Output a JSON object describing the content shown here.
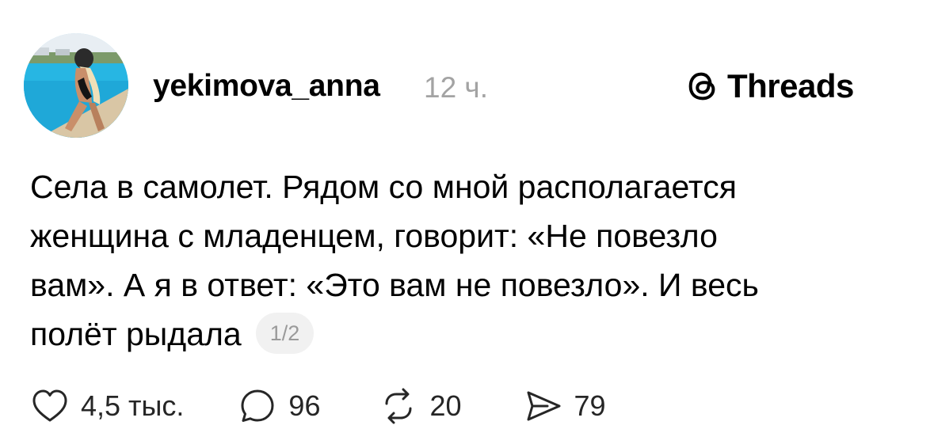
{
  "post": {
    "author": "yekimova_anna",
    "time": "12 ч.",
    "brand": "Threads",
    "text_lines": [
      "Села в самолет. Рядом со мной располагается",
      "женщина с младенцем, говорит: «Не повезло",
      "вам». А я в ответ: «Это вам не повезло». И весь",
      "полёт рыдала"
    ],
    "page_indicator": "1/2"
  },
  "actions": {
    "likes": "4,5 тыс.",
    "comments": "96",
    "reposts": "20",
    "shares": "79"
  },
  "icons": {
    "avatar": "profile-photo",
    "brand": "threads-logo-icon",
    "like": "heart-icon",
    "comment": "comment-bubble-icon",
    "repost": "repost-icon",
    "share": "send-icon"
  }
}
